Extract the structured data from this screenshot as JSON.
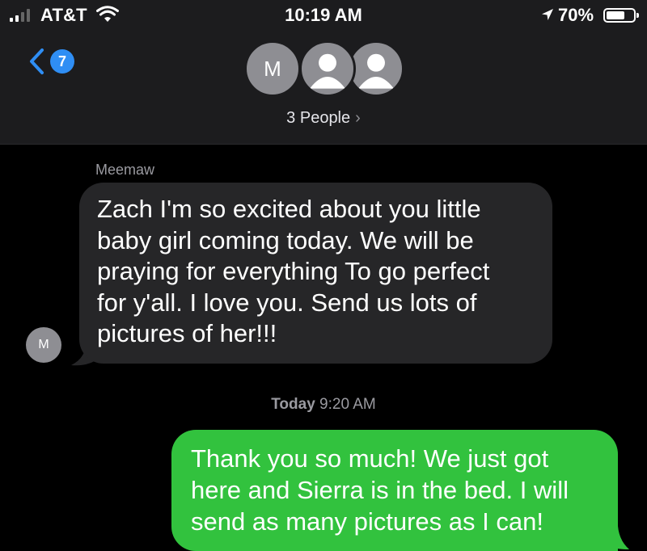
{
  "status_bar": {
    "carrier": "AT&T",
    "time": "10:19 AM",
    "battery_percent": "70%",
    "battery_level": 0.7,
    "signal_bars_active": 2,
    "signal_bars_total": 4
  },
  "header": {
    "back_badge_count": "7",
    "avatar_letter": "M",
    "people_label": "3 People",
    "people_chevron": "›"
  },
  "messages": {
    "incoming": {
      "sender": "Meemaw",
      "avatar_letter": "M",
      "text": "Zach I'm so excited about you little\nbaby girl coming today.  We will be\npraying for everything To go perfect\nfor y'all.  I love you. Send us lots of\npictures of her!!!"
    },
    "timestamp_day": "Today",
    "timestamp_time": "9:20 AM",
    "outgoing": {
      "text": "Thank you so much! We just got\nhere and Sierra is in the bed. I will\nsend as many pictures as I can!"
    }
  },
  "colors": {
    "incoming_bubble": "#262628",
    "outgoing_bubble": "#32c23e",
    "badge": "#2f8ef4",
    "background": "#000000"
  }
}
